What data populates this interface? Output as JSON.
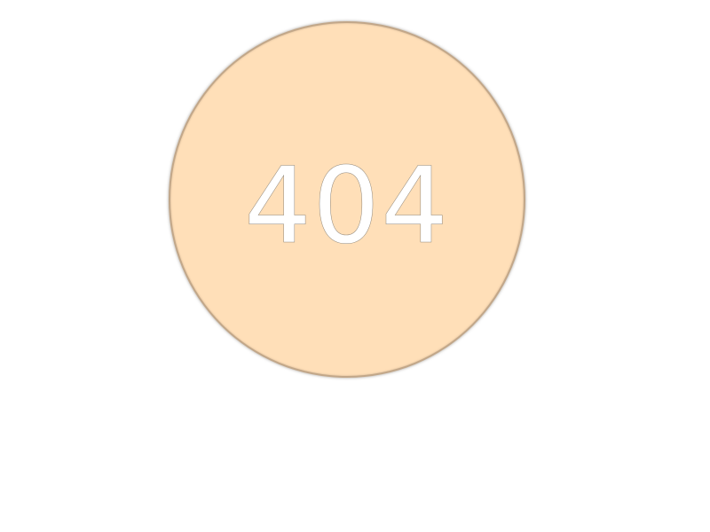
{
  "error": {
    "code": "404"
  },
  "colors": {
    "circle_fill": "#ffdfb8",
    "text": "#ffffff",
    "background": "#ffffff"
  }
}
